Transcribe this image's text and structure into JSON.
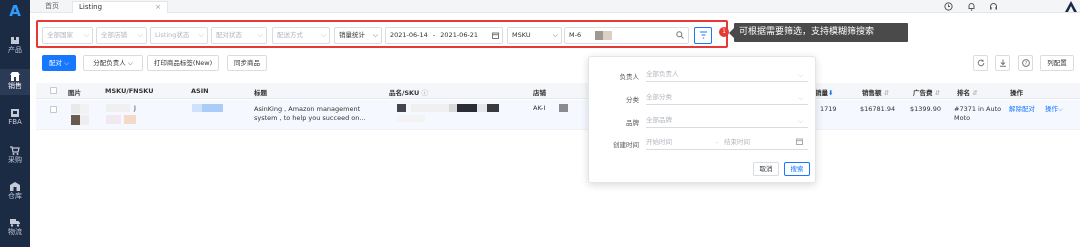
{
  "sidebar": {
    "logo": "A",
    "items": [
      {
        "label": "产品",
        "icon": "box-icon"
      },
      {
        "label": "销售",
        "icon": "shop-icon",
        "active": true
      },
      {
        "label": "FBA",
        "icon": "warehouse-icon"
      },
      {
        "label": "采购",
        "icon": "cart-icon"
      },
      {
        "label": "仓库",
        "icon": "store-icon"
      },
      {
        "label": "物流",
        "icon": "truck-icon"
      }
    ]
  },
  "topbar": {
    "home_tab": "首页",
    "active_tab": "Listing",
    "close_glyph": "×",
    "icons": [
      "clock-icon",
      "bell-icon",
      "headset-icon",
      "user-avatar-icon"
    ]
  },
  "filters": {
    "country": "全部国家",
    "store": "全部店铺",
    "listing_status": "Listing状态",
    "pairing_status": "配对状态",
    "delivery_method": "配送方式",
    "stats_type": "销量统计",
    "date_start": "2021-06-14",
    "date_sep": "-",
    "date_end": "2021-06-21",
    "search_field": "MSKU",
    "search_value": "M-6"
  },
  "annotation": {
    "badge": "1",
    "text": "可根据需要筛选，支持模糊筛搜索"
  },
  "toolbar": {
    "pair_label": "配对",
    "assign_label": "分配负责人",
    "print_label": "打印商品标签(New)",
    "sync_label": "同步商品",
    "column_config_label": "列配置"
  },
  "table": {
    "headers": [
      "图片",
      "MSKU/FNSKU",
      "ASIN",
      "标题",
      "品名/SKU",
      "店铺",
      "销量",
      "销售额",
      "广告费",
      "排名",
      "操作"
    ],
    "rows": [
      {
        "msku_suffix": "J",
        "title": "AsinKing , Amazon management system , to help you succeed on...",
        "store": "AK-I",
        "sales": "1719",
        "revenue": "$16781.94",
        "ad_cost": "$1399.90",
        "rank": "#7371 in Auto Moto",
        "action_unpair": "解除配对",
        "action_more": "操作"
      }
    ]
  },
  "dropdown": {
    "fields": [
      {
        "label": "负责人",
        "placeholder": "全部负责人"
      },
      {
        "label": "分类",
        "placeholder": "全部分类"
      },
      {
        "label": "品牌",
        "placeholder": "全部品牌"
      }
    ],
    "created_label": "创建时间",
    "start_placeholder": "开始时间",
    "range_sep": "-",
    "end_placeholder": "结束时间",
    "cancel_label": "取消",
    "search_label": "搜索"
  },
  "colors": {
    "accent": "#1677ff",
    "highlight": "#e53935",
    "sidebar": "#1c2b44"
  }
}
